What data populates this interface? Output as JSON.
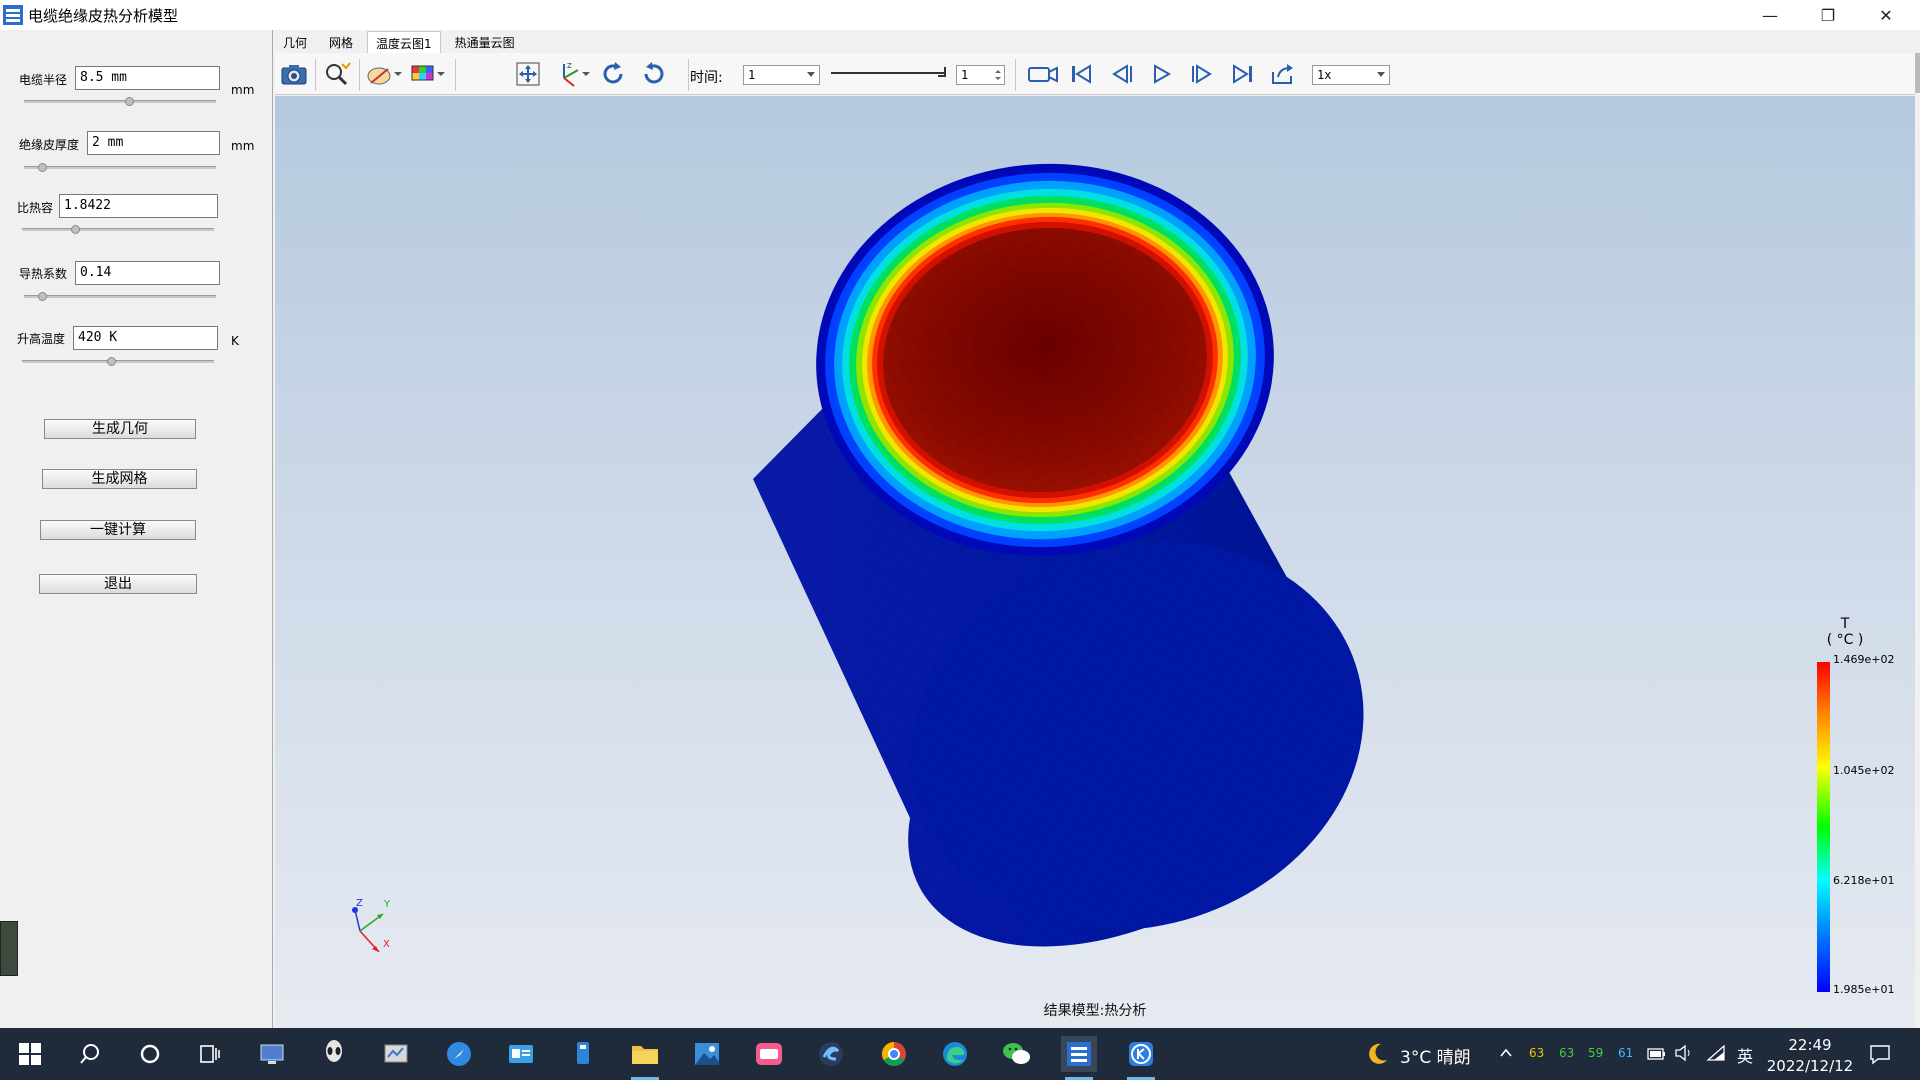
{
  "window": {
    "title": "电缆绝缘皮热分析模型",
    "controls": {
      "minimize": "—",
      "maximize": "❐",
      "close": "✕"
    }
  },
  "params": [
    {
      "label": "电缆半径",
      "value": "8.5 mm",
      "unit": "mm",
      "slider_level": 0.55
    },
    {
      "label": "绝缘皮厚度",
      "value": "2 mm",
      "unit": "mm",
      "slider_level": 0.1
    },
    {
      "label": "比热容",
      "value": "1.8422",
      "unit": "",
      "slider_level": 0.28
    },
    {
      "label": "导热系数",
      "value": "0.14",
      "unit": "",
      "slider_level": 0.1
    },
    {
      "label": "升高温度",
      "value": "420 K",
      "unit": "K",
      "slider_level": 0.47
    }
  ],
  "buttons": {
    "generate_geometry": "生成几何",
    "generate_mesh": "生成网格",
    "one_click_compute": "一键计算",
    "exit": "退出"
  },
  "menu_tabs": [
    "几何",
    "网格",
    "温度云图1",
    "热通量云图"
  ],
  "active_tab": 2,
  "toolbar": {
    "time_label": "时间:",
    "time_value": "1",
    "frame_value": "1",
    "speed_value": "1x",
    "icons": [
      "camera-icon",
      "zoom-pick-icon",
      "view-select-icon",
      "color-cube-icon",
      "fit-view-icon",
      "axis-orient-icon",
      "rotate-cw-icon",
      "rotate-ccw-icon",
      "record-video-icon",
      "first-frame-icon",
      "prev-frame-icon",
      "play-icon",
      "next-frame-icon",
      "last-frame-icon",
      "export-icon"
    ]
  },
  "viewport": {
    "status_text": "结果模型:热分析",
    "legend": {
      "title_line1": "T",
      "title_line2": "( °C )",
      "labels": [
        "1.469e+02",
        "1.045e+02",
        "6.218e+01",
        "1.985e+01"
      ]
    },
    "axes": {
      "x": "X",
      "y": "Y",
      "z": "Z"
    }
  },
  "taskbar": {
    "weather": "3°C 晴朗",
    "tray_numbers": [
      "63",
      "63",
      "59",
      "61"
    ],
    "tray_number_colors": [
      "#e8c300",
      "#3fd13f",
      "#3fd13f",
      "#3fb8ff"
    ],
    "ime": "英",
    "time": "22:49",
    "date": "2022/12/12"
  },
  "colors": {
    "hot": "#8b0000",
    "cold": "#0014a0",
    "accent": "#1e6fd6"
  }
}
